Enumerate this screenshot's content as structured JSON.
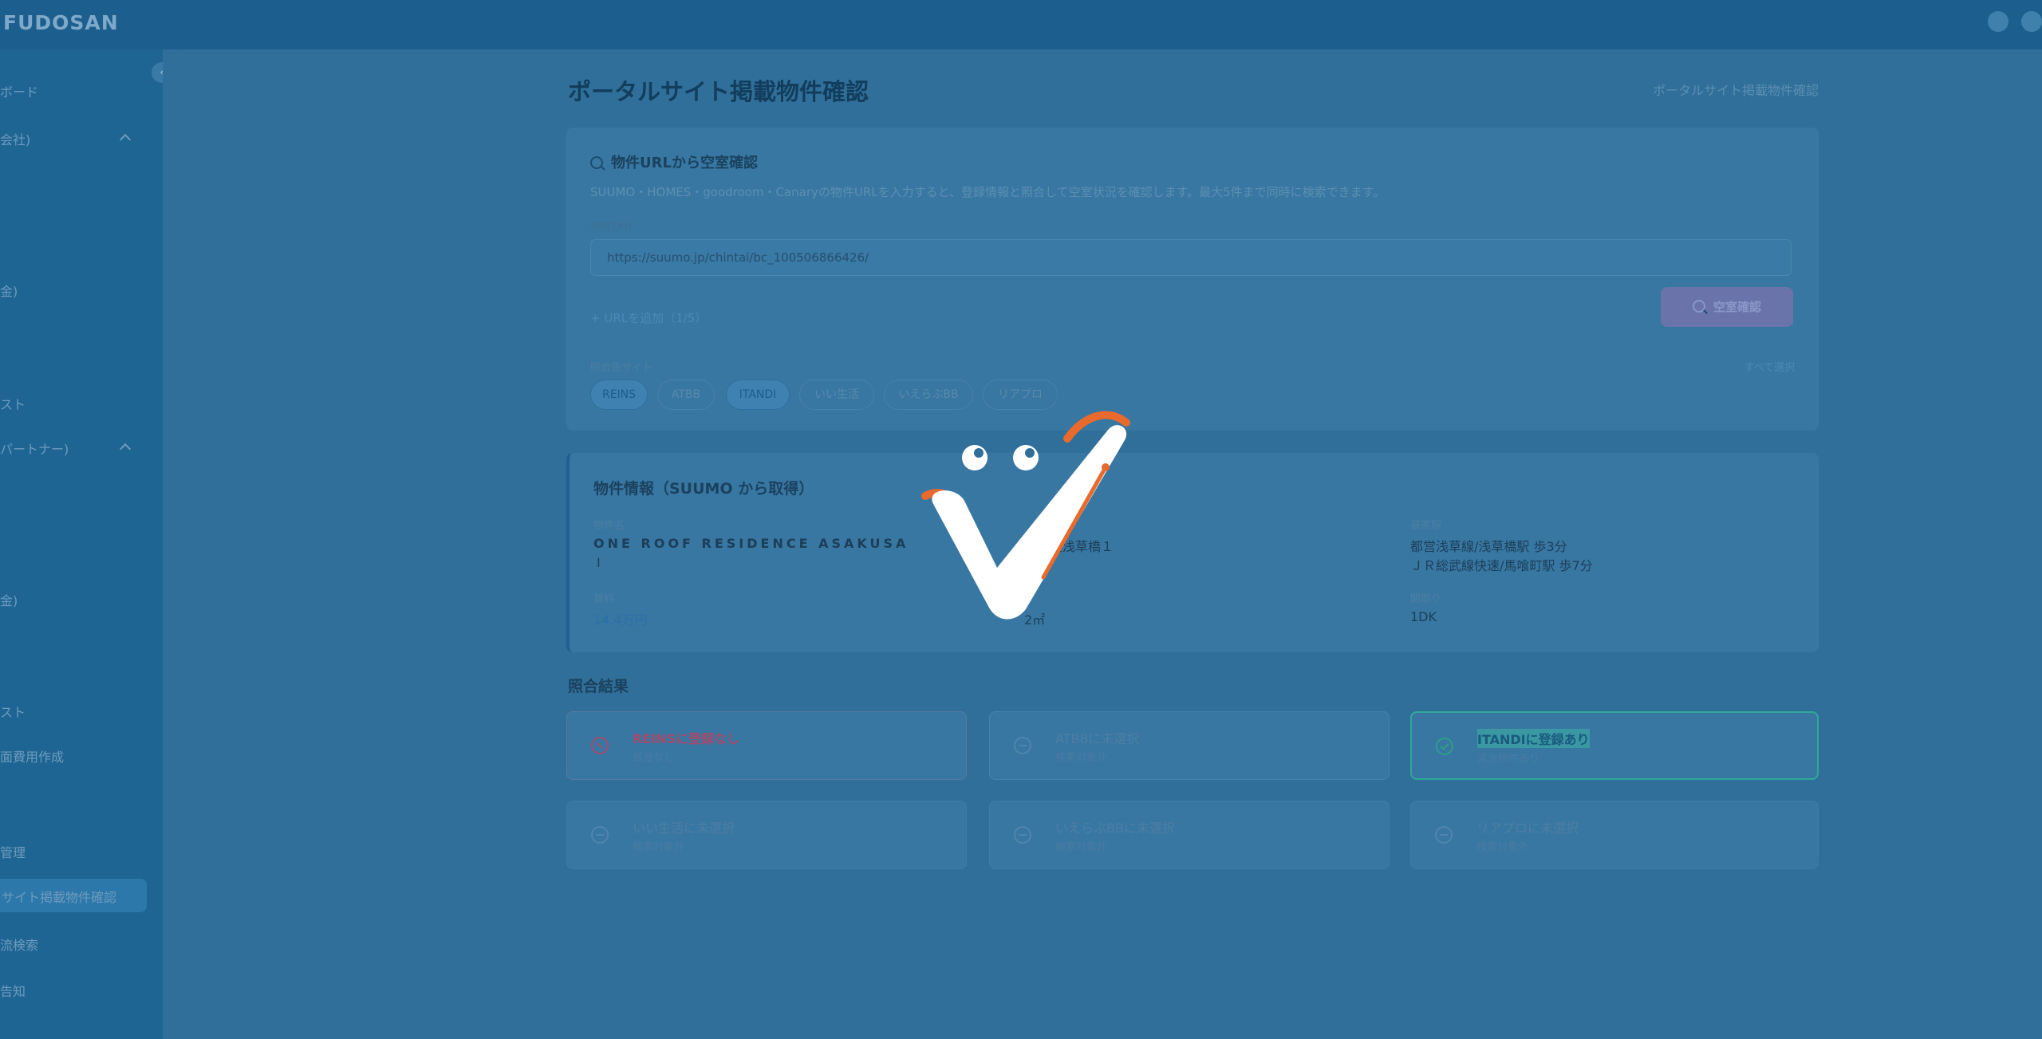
{
  "app": {
    "brand": "FUDOSAN"
  },
  "sidebar": {
    "items": [
      {
        "label": "ボード"
      },
      {
        "label": "会社)"
      },
      {
        "label": "金)"
      },
      {
        "label": "スト"
      },
      {
        "label": "パートナー)"
      },
      {
        "label": "金)"
      },
      {
        "label": "スト"
      },
      {
        "label": "面費用作成"
      },
      {
        "label": "管理"
      },
      {
        "label": "サイト掲載物件確認"
      },
      {
        "label": "流検索"
      },
      {
        "label": "告知"
      }
    ]
  },
  "header": {
    "title": "ポータルサイト掲載物件確認",
    "breadcrumb": "ポータルサイト掲載物件確認"
  },
  "search_card": {
    "title": "物件URLから空室確認",
    "description": "SUUMO・HOMES・goodroom・Canaryの物件URLを入力すると、登録情報と照合して空室状況を確認します。最大5件まで同時に検索できます。",
    "url_label": "物件URL",
    "url_value": "https://suumo.jp/chintai/bc_100506866426/",
    "add_url_label": "+ URLを追加（1/5）",
    "check_button": "空室確認",
    "source_label": "照合先サイト",
    "select_all": "すべて選択",
    "sources": [
      {
        "label": "REINS",
        "selected": true
      },
      {
        "label": "ATBB",
        "selected": false
      },
      {
        "label": "ITANDI",
        "selected": true
      },
      {
        "label": "いい生活",
        "selected": false
      },
      {
        "label": "いえらぶBB",
        "selected": false
      },
      {
        "label": "リアプロ",
        "selected": false
      }
    ]
  },
  "property": {
    "title": "物件情報（SUUMO から取得）",
    "name_label": "物件名",
    "name_value": "ONE ROOF RESIDENCE ASAKUSA",
    "name_value_2": "Ⅰ",
    "address_value": "台東区浅草橋１",
    "station_label": "最寄駅",
    "station_1": "都営浅草線/浅草橋駅 歩3分",
    "station_2": "ＪＲ総武線快速/馬喰町駅 歩7分",
    "rent_label": "賃料",
    "rent_value": "14.4万円",
    "area_value": "2㎡",
    "layout_label": "間取り",
    "layout_value": "1DK"
  },
  "results": {
    "title": "照合結果",
    "items": [
      {
        "title": "REINSに登録なし",
        "sub": "該当なし",
        "state": "miss"
      },
      {
        "title": "ATBBに未選択",
        "sub": "検索対象外",
        "state": "none"
      },
      {
        "title": "ITANDIに登録あり",
        "sub": "該当物件あり",
        "state": "hit"
      },
      {
        "title": "いい生活に未選択",
        "sub": "検索対象外",
        "state": "none"
      },
      {
        "title": "いえらぶBBに未選択",
        "sub": "検索対象外",
        "state": "none"
      },
      {
        "title": "リアプロに未選択",
        "sub": "検索対象外",
        "state": "none"
      }
    ]
  },
  "colors": {
    "overlay": "#2f6f99",
    "accent_orange": "#e86a2c",
    "hit": "#31a79a",
    "miss": "#a54c72"
  }
}
